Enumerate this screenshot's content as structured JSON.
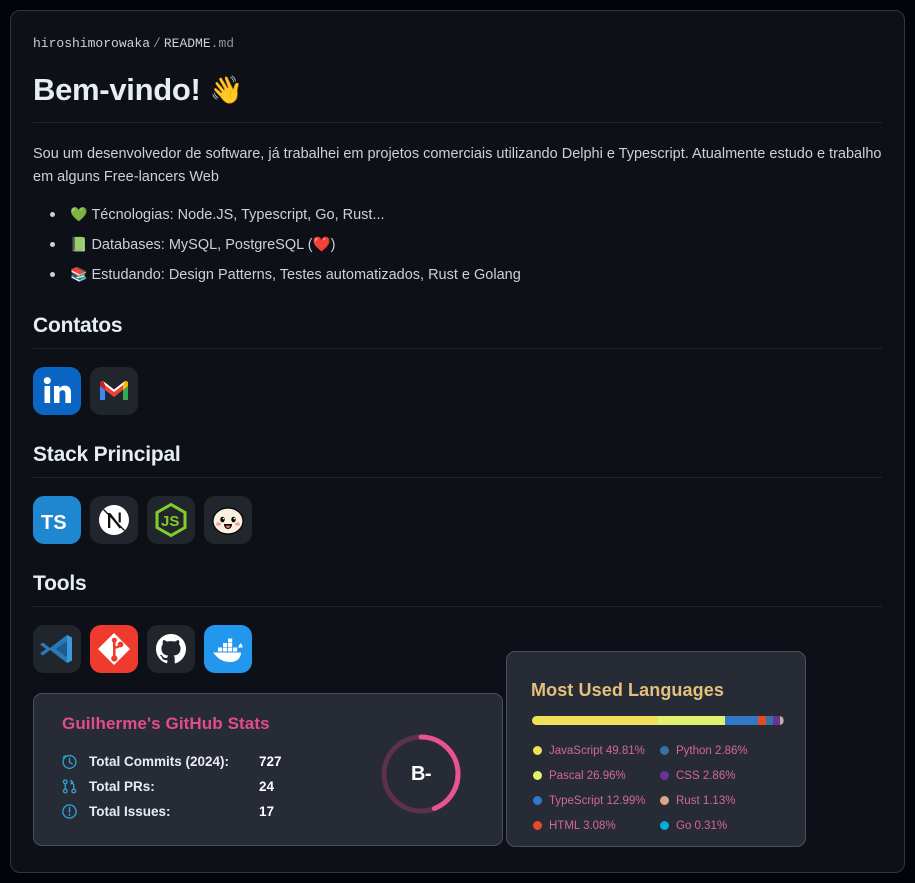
{
  "breadcrumb": {
    "owner": "hiroshimorowaka",
    "separator": "/",
    "file_name": "README",
    "file_ext": ".md"
  },
  "title": {
    "text": "Bem-vindo!",
    "emoji": "👋",
    "emoji_name": "waving-hand"
  },
  "intro": "Sou um desenvolvedor de software, já trabalhei em projetos comerciais utilizando Delphi e Typescript. Atualmente estudo e trabalho em alguns Free-lancers Web",
  "bullets": [
    {
      "emoji": "💚",
      "emoji_name": "green-heart",
      "text": "Técnologias: Node.JS, Typescript, Go, Rust..."
    },
    {
      "emoji": "📗",
      "emoji_name": "green-book",
      "text": "Databases: MySQL, PostgreSQL (❤️)"
    },
    {
      "emoji": "📚",
      "emoji_name": "books",
      "text": "Estudando: Design Patterns, Testes automatizados, Rust e Golang"
    }
  ],
  "sections": {
    "contatos": {
      "heading": "Contatos",
      "icons": [
        {
          "name": "linkedin-icon",
          "label": "LinkedIn"
        },
        {
          "name": "gmail-icon",
          "label": "Gmail"
        }
      ]
    },
    "stack": {
      "heading": "Stack Principal",
      "icons": [
        {
          "name": "typescript-icon",
          "label": "TypeScript"
        },
        {
          "name": "nextjs-icon",
          "label": "Next.js"
        },
        {
          "name": "nodejs-icon",
          "label": "Node.js"
        },
        {
          "name": "bun-icon",
          "label": "Bun"
        }
      ]
    },
    "tools": {
      "heading": "Tools",
      "icons": [
        {
          "name": "vscode-icon",
          "label": "Visual Studio Code"
        },
        {
          "name": "git-icon",
          "label": "Git"
        },
        {
          "name": "github-icon",
          "label": "GitHub"
        },
        {
          "name": "docker-icon",
          "label": "Docker"
        }
      ]
    }
  },
  "github_stats": {
    "title": "Guilherme's GitHub Stats",
    "title_color": "#e34c89",
    "rows": [
      {
        "icon": "clock-icon",
        "label": "Total Commits (2024):",
        "value": "727"
      },
      {
        "icon": "pull-request-icon",
        "label": "Total PRs:",
        "value": "24"
      },
      {
        "icon": "issue-opened-icon",
        "label": "Total Issues:",
        "value": "17"
      }
    ],
    "rank": {
      "grade": "B-",
      "progress_percent": 44,
      "ring_color": "#e8548c",
      "track_color": "#5d3148"
    }
  },
  "chart_data": {
    "type": "bar",
    "title": "Most Used Languages",
    "title_color": "#e4c07a",
    "subtype": "stacked-horizontal-percentage",
    "categories": [
      "JavaScript",
      "Pascal",
      "TypeScript",
      "HTML",
      "Python",
      "CSS",
      "Rust",
      "Go"
    ],
    "values": [
      49.81,
      26.96,
      12.99,
      3.08,
      2.86,
      2.86,
      1.13,
      0.31
    ],
    "unit": "%",
    "colors": [
      "#f1e05a",
      "#e3f171",
      "#3178c6",
      "#e34c26",
      "#3572a5",
      "#663399",
      "#dea584",
      "#00add8"
    ],
    "legend": [
      {
        "label": "JavaScript 49.81%",
        "color": "#f1e05a"
      },
      {
        "label": "Pascal 26.96%",
        "color": "#e3f171"
      },
      {
        "label": "TypeScript 12.99%",
        "color": "#3178c6"
      },
      {
        "label": "HTML 3.08%",
        "color": "#e34c26"
      },
      {
        "label": "Python 2.86%",
        "color": "#3572a5"
      },
      {
        "label": "CSS 2.86%",
        "color": "#663399"
      },
      {
        "label": "Rust 1.13%",
        "color": "#dea584"
      },
      {
        "label": "Go 0.31%",
        "color": "#00add8"
      }
    ],
    "legend_position": "below-bar-two-columns",
    "legend_text_color": "#d4698f",
    "grid": false,
    "xlabel": "",
    "ylabel": ""
  }
}
